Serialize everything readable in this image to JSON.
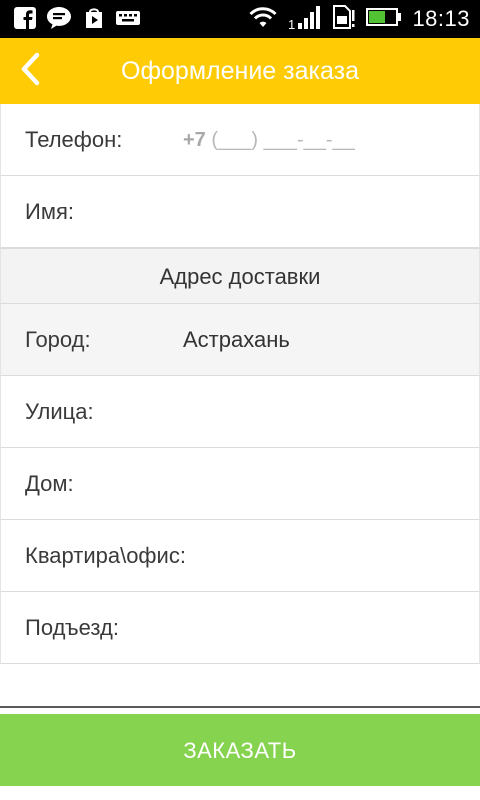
{
  "status_bar": {
    "time": "18:13",
    "left_icons": [
      "facebook-icon",
      "chat-icon",
      "play-store-icon",
      "keyboard-icon"
    ],
    "right_icons": [
      "wifi-icon",
      "signal-icon",
      "sim-card-icon",
      "battery-icon"
    ],
    "signal_badge": "1"
  },
  "header": {
    "title": "Оформление заказа",
    "back_icon": "chevron-left-icon",
    "background": "#ffcb05"
  },
  "form": {
    "phone": {
      "label": "Телефон:",
      "prefix": "+7",
      "mask": "(___) ___-__-__"
    },
    "name": {
      "label": "Имя:",
      "value": ""
    },
    "address_section": "Адрес доставки",
    "city": {
      "label": "Город:",
      "value": "Астрахань"
    },
    "street": {
      "label": "Улица:",
      "value": ""
    },
    "house": {
      "label": "Дом:",
      "value": ""
    },
    "apartment": {
      "label": "Квартира\\офис:",
      "value": ""
    },
    "entrance": {
      "label": "Подъезд:",
      "value": ""
    }
  },
  "order_button": {
    "label": "ЗАКАЗАТЬ",
    "background": "#86d350"
  }
}
